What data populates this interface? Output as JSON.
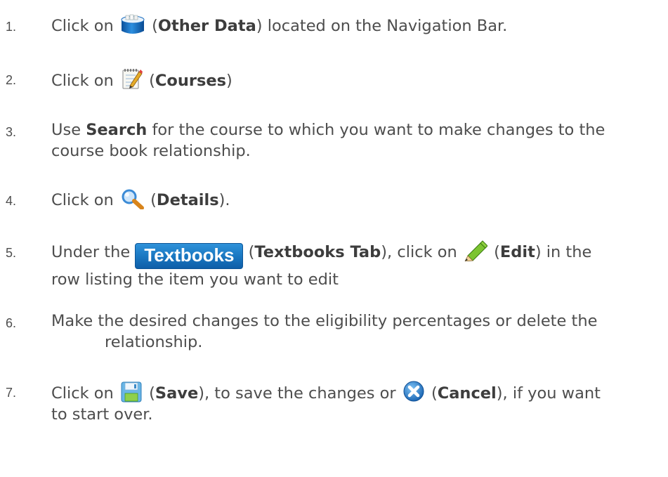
{
  "steps": [
    {
      "num": "1.",
      "pre": "Click on",
      "icon": "other-data-icon",
      "bold": "Other Data",
      "post": "located on the Navigation Bar."
    },
    {
      "num": "2.",
      "pre": "Click on",
      "icon": "courses-icon",
      "bold": "Courses"
    },
    {
      "num": "3.",
      "pre": "Use",
      "bold": "Search",
      "post": "for the course to which you want to make changes to the",
      "line2": "course book relationship."
    },
    {
      "num": "4.",
      "pre": "Click on",
      "icon": "magnifier-icon",
      "bold": "Details"
    },
    {
      "num": "5.",
      "pre": "Under the",
      "tab_label": "Textbooks",
      "bold": "Textbooks Tab",
      "mid": ", click on",
      "icon2": "pencil-icon",
      "bold2": "Edit",
      "post": "in the",
      "line2": "row listing the item you want to edit"
    },
    {
      "num": "6.",
      "text": "Make the desired changes to the eligibility percentages or delete the",
      "line2": "relationship."
    },
    {
      "num": "7.",
      "pre": "Click on",
      "icon": "save-icon",
      "bold": "Save",
      "mid": ", to save the changes or",
      "icon2": "cancel-icon",
      "bold2": "Cancel",
      "post": ", if you want",
      "line2": "to start over."
    }
  ]
}
